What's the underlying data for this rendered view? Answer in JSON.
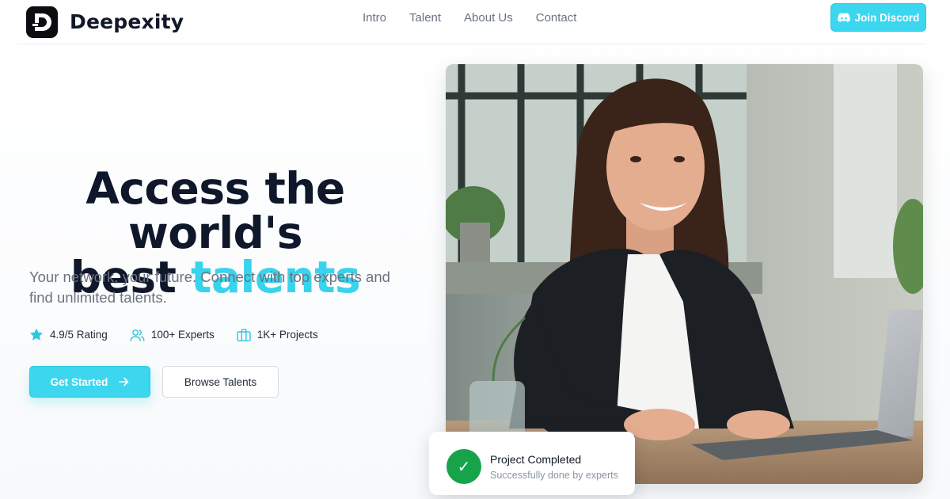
{
  "brand": {
    "name": "Deepexity",
    "logo_icon": "deepexity-logo-icon"
  },
  "nav": {
    "items": [
      {
        "label": "Intro"
      },
      {
        "label": "Talent"
      },
      {
        "label": "About Us"
      },
      {
        "label": "Contact"
      }
    ]
  },
  "header": {
    "discord_label": "Join Discord",
    "discord_icon": "discord-icon"
  },
  "hero": {
    "title_line1": "Access the world's",
    "title_line2_plain": "best",
    "title_line2_accent": "talents",
    "subtitle": "Your network, your future. Connect with top experts and find unlimited talents."
  },
  "stats": [
    {
      "label": "4.9/5 Rating",
      "icon": "star-icon"
    },
    {
      "label": "100+ Experts",
      "icon": "users-icon"
    },
    {
      "label": "1K+ Projects",
      "icon": "briefcase-icon"
    }
  ],
  "cta": {
    "primary_label": "Get Started",
    "primary_icon": "arrow-right-icon",
    "secondary_label": "Browse Talents"
  },
  "badge": {
    "title": "Project Completed",
    "subtitle": "Successfully done by experts",
    "check_symbol": "✓"
  },
  "colors": {
    "accent": "#38d3ec",
    "button": "#3cd6ef",
    "success": "#16a34a",
    "text_dark": "#0f172a",
    "text_muted": "#6b7280"
  }
}
